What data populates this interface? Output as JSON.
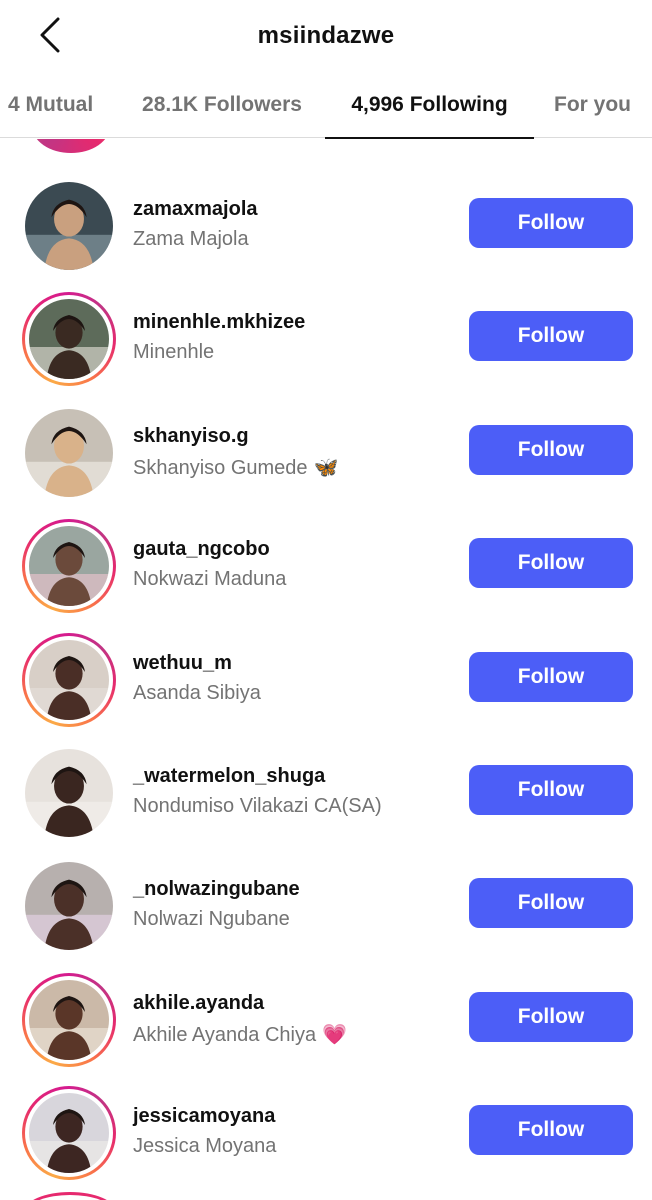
{
  "header": {
    "title": "msiindazwe",
    "back_icon": "chevron-left-icon"
  },
  "tabs": [
    {
      "label": "4 Mutual",
      "active": false
    },
    {
      "label": "28.1K Followers",
      "active": false
    },
    {
      "label": "4,996 Following",
      "active": true
    },
    {
      "label": "For you",
      "active": false
    }
  ],
  "colors": {
    "follow_button": "#4c5ef7",
    "story_ring_start": "#fbaa47",
    "story_ring_end": "#c13584"
  },
  "users": [
    {
      "username": "zamaxmajola",
      "full_name": "Zama Majola",
      "emoji": "",
      "story_ring": false,
      "button_label": "Follow"
    },
    {
      "username": "minenhle.mkhizee",
      "full_name": "Minenhle",
      "emoji": "",
      "story_ring": true,
      "button_label": "Follow"
    },
    {
      "username": "skhanyiso.g",
      "full_name": "Skhanyiso Gumede",
      "emoji": "🦋",
      "story_ring": false,
      "button_label": "Follow"
    },
    {
      "username": "gauta_ngcobo",
      "full_name": "Nokwazi Maduna",
      "emoji": "",
      "story_ring": true,
      "button_label": "Follow"
    },
    {
      "username": "wethuu_m",
      "full_name": "Asanda Sibiya",
      "emoji": "",
      "story_ring": true,
      "button_label": "Follow"
    },
    {
      "username": "_watermelon_shuga",
      "full_name": "Nondumiso Vilakazi CA(SA)",
      "emoji": "",
      "story_ring": false,
      "button_label": "Follow"
    },
    {
      "username": "_nolwazingubane",
      "full_name": "Nolwazi Ngubane",
      "emoji": "",
      "story_ring": false,
      "button_label": "Follow"
    },
    {
      "username": "akhile.ayanda",
      "full_name": "Akhile Ayanda Chiya",
      "emoji": "💗",
      "story_ring": true,
      "button_label": "Follow"
    },
    {
      "username": "jessicamoyana",
      "full_name": "Jessica Moyana",
      "emoji": "",
      "story_ring": true,
      "button_label": "Follow"
    }
  ]
}
